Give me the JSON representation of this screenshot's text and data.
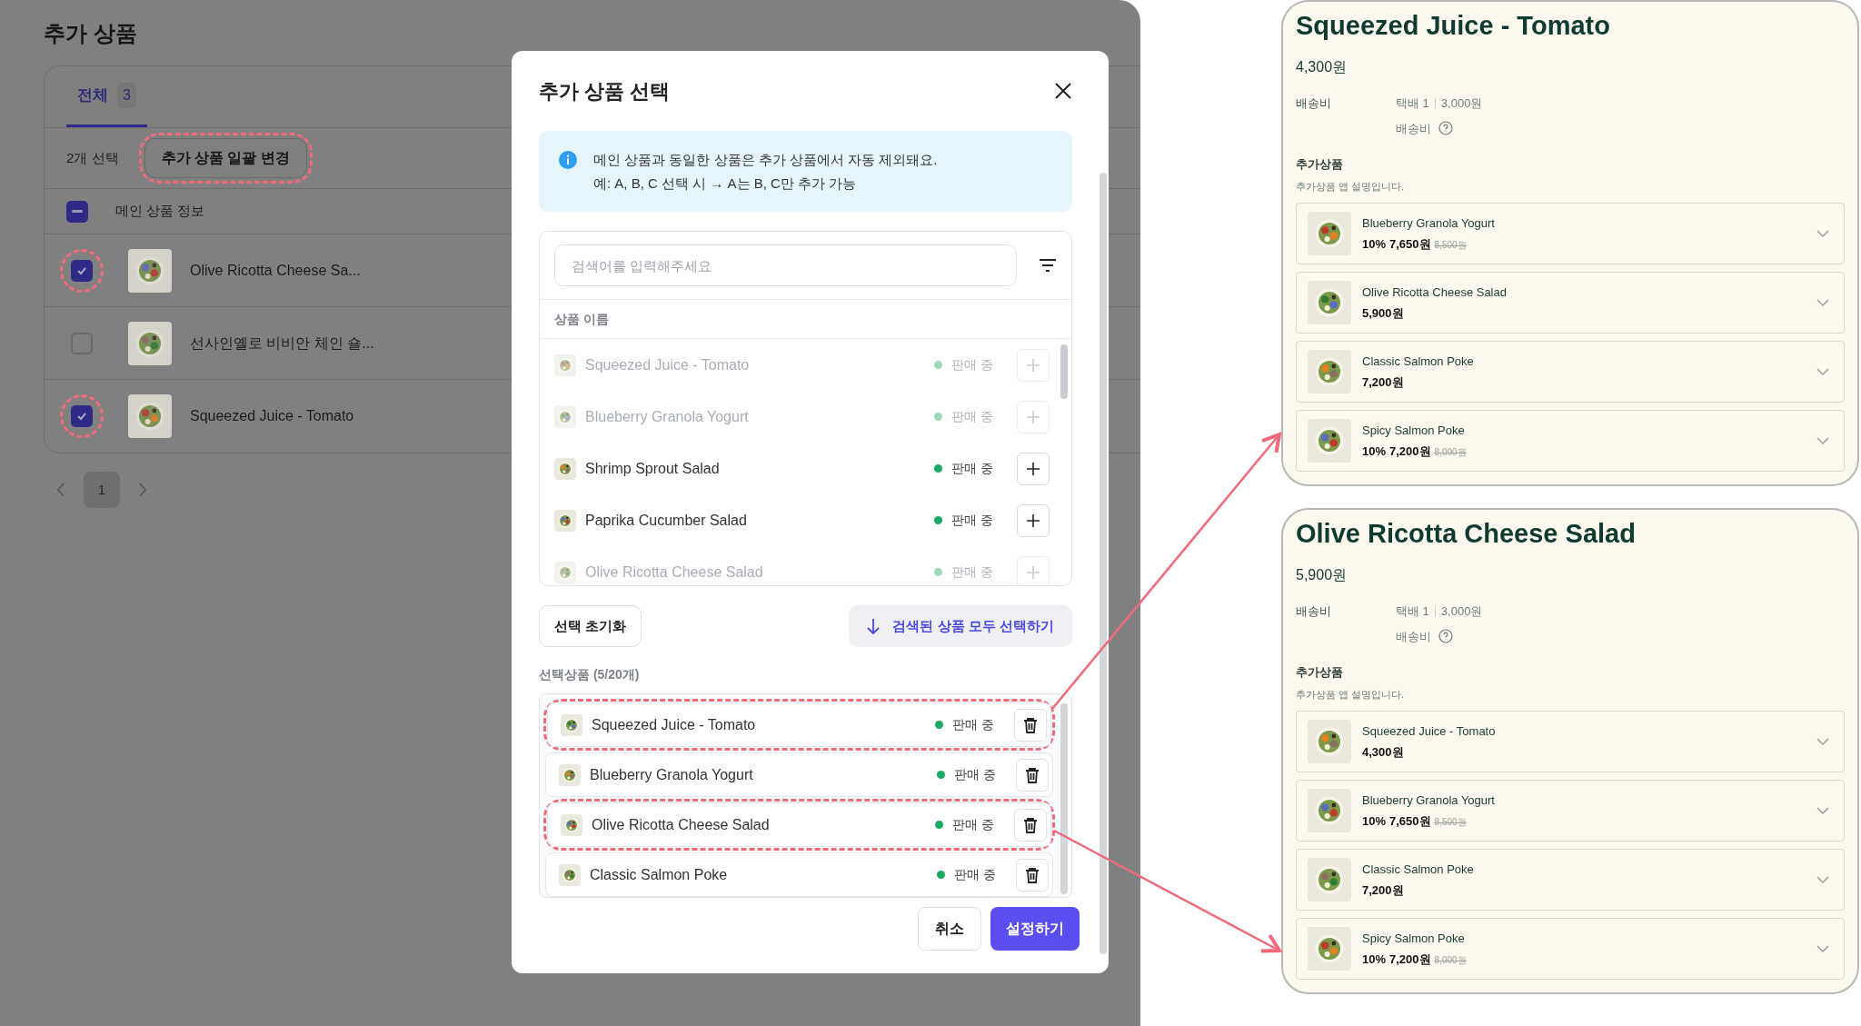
{
  "page": {
    "title": "추가 상품",
    "tabs": [
      {
        "label": "전체",
        "count": "3",
        "selected": true
      }
    ],
    "selection_count": "2개 선택",
    "bulk_button": {
      "label": "추가 상품 일괄 변경",
      "highlighted": true
    },
    "table": {
      "header": {
        "label": "메인 상품 정보",
        "checked": true,
        "indeterminate": true
      },
      "rows": [
        {
          "name": "Olive Ricotta Cheese Sa...",
          "checked": true,
          "highlighted": true
        },
        {
          "name": "선사인옐로 비비안 체인 숄...",
          "checked": false,
          "highlighted": false
        },
        {
          "name": "Squeezed Juice - Tomato",
          "checked": true,
          "highlighted": true
        }
      ]
    },
    "pagination": {
      "pages": [
        {
          "label": "1",
          "selected": true
        }
      ]
    }
  },
  "modal": {
    "title": "추가 상품 선택",
    "info_lines": [
      "메인 상품과 동일한 상품은 추가 상품에서 자동 제외돼요.",
      "예: A, B, C 선택 시 → A는 B, C만 추가 가능"
    ],
    "search": {
      "placeholder": "검색어를 입력해주세요"
    },
    "column": "상품 이름",
    "products": [
      {
        "name": "Squeezed Juice - Tomato",
        "status": "판매 중",
        "disabled": true
      },
      {
        "name": "Blueberry Granola Yogurt",
        "status": "판매 중",
        "disabled": true
      },
      {
        "name": "Shrimp Sprout Salad",
        "status": "판매 중",
        "disabled": false
      },
      {
        "name": "Paprika Cucumber Salad",
        "status": "판매 중",
        "disabled": false
      },
      {
        "name": "Olive Ricotta Cheese Salad",
        "status": "판매 중",
        "disabled": true
      }
    ],
    "reset_button": "선택 초기화",
    "select_all_button": "검색된 상품 모두 선택하기",
    "selected_label": "선택상품 (5/20개)",
    "selected": [
      {
        "name": "Squeezed Juice - Tomato",
        "status": "판매 중",
        "highlighted": true
      },
      {
        "name": "Blueberry Granola Yogurt",
        "status": "판매 중",
        "highlighted": false
      },
      {
        "name": "Olive Ricotta Cheese Salad",
        "status": "판매 중",
        "highlighted": true
      },
      {
        "name": "Classic Salmon Poke",
        "status": "판매 중",
        "highlighted": false
      }
    ],
    "cancel_button": "취소",
    "confirm_button": "설정하기"
  },
  "previews": [
    {
      "title": "Squeezed Juice - Tomato",
      "price": "4,300원",
      "shipping_label": "배송비",
      "shipping_method": "택배 1",
      "shipping_fee": "3,000원",
      "shipping_note": "배송비",
      "addons_title": "추가상품",
      "addons_desc": "추가상품 앱 설명입니다.",
      "addons": [
        {
          "name": "Blueberry Granola Yogurt",
          "discount": "10%",
          "price": "7,650원",
          "original_price": "8,500원"
        },
        {
          "name": "Olive Ricotta Cheese Salad",
          "price": "5,900원"
        },
        {
          "name": "Classic Salmon Poke",
          "price": "7,200원"
        },
        {
          "name": "Spicy Salmon Poke",
          "discount": "10%",
          "price": "7,200원",
          "original_price": "8,000원"
        }
      ]
    },
    {
      "title": "Olive Ricotta Cheese Salad",
      "price": "5,900원",
      "shipping_label": "배송비",
      "shipping_method": "택배 1",
      "shipping_fee": "3,000원",
      "shipping_note": "배송비",
      "addons_title": "추가상품",
      "addons_desc": "추가상품 앱 설명입니다.",
      "addons": [
        {
          "name": "Squeezed Juice - Tomato",
          "price": "4,300원"
        },
        {
          "name": "Blueberry Granola Yogurt",
          "discount": "10%",
          "price": "7,650원",
          "original_price": "8,500원"
        },
        {
          "name": "Classic Salmon Poke",
          "price": "7,200원"
        },
        {
          "name": "Spicy Salmon Poke",
          "discount": "10%",
          "price": "7,200원",
          "original_price": "8,000원"
        }
      ]
    }
  ]
}
